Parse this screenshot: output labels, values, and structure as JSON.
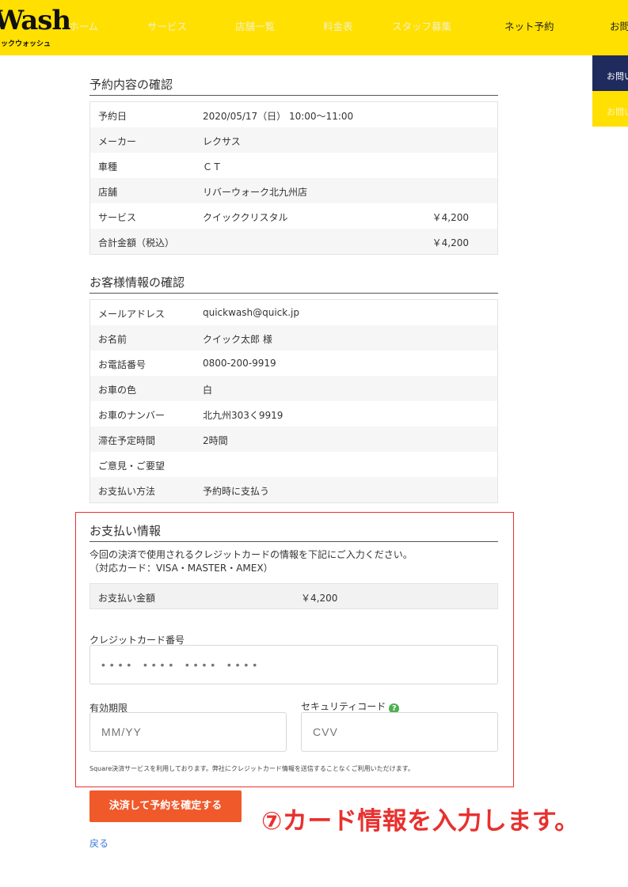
{
  "header": {
    "logo_main": "Wash",
    "logo_sub": "イックウォッシュ",
    "nav": [
      {
        "label": "ホーム"
      },
      {
        "label": "サービス"
      },
      {
        "label": "店舗一覧"
      },
      {
        "label": "料金表"
      },
      {
        "label": "スタッフ募集"
      },
      {
        "label": "ネット予約"
      },
      {
        "label": "お問"
      }
    ]
  },
  "side": {
    "contact_navy": "お問い",
    "contact_yellow": "お問い"
  },
  "reservation": {
    "title": "予約内容の確認",
    "rows": [
      {
        "k": "予約日",
        "v": "2020/05/17（日） 10:00〜11:00",
        "p": ""
      },
      {
        "k": "メーカー",
        "v": "レクサス",
        "p": ""
      },
      {
        "k": "車種",
        "v": "ＣＴ",
        "p": ""
      },
      {
        "k": "店舗",
        "v": "リバーウォーク北九州店",
        "p": ""
      },
      {
        "k": "サービス",
        "v": "クイッククリスタル",
        "p": "￥4,200"
      },
      {
        "k": "合計金額（税込）",
        "v": "",
        "p": "￥4,200"
      }
    ]
  },
  "customer": {
    "title": "お客様情報の確認",
    "rows": [
      {
        "k": "メールアドレス",
        "v": "quickwash@quick.jp"
      },
      {
        "k": "お名前",
        "v": "クイック太郎 様"
      },
      {
        "k": "お電話番号",
        "v": "0800-200-9919"
      },
      {
        "k": "お車の色",
        "v": "白"
      },
      {
        "k": "お車のナンバー",
        "v": "北九州303く9919"
      },
      {
        "k": "滞在予定時間",
        "v": "2時間"
      },
      {
        "k": "ご意見・ご要望",
        "v": ""
      },
      {
        "k": "お支払い方法",
        "v": "予約時に支払う"
      }
    ]
  },
  "payment": {
    "title": "お支払い情報",
    "desc_line1": "今回の決済で使用されるクレジットカードの情報を下記にご入力ください。",
    "desc_line2": "（対応カード：VISA・MASTER・AMEX）",
    "amount_label": "お支払い金額",
    "amount_value": "￥4,200",
    "card_label": "クレジットカード番号",
    "card_placeholder": "• • • •   • • • •   • • • •   • • • •",
    "expiry_label": "有効期限",
    "expiry_placeholder": "MM/YY",
    "cvv_label": "セキュリティコード",
    "cvv_help": "?",
    "cvv_placeholder": "CVV",
    "note": "Square決済サービスを利用しております。弊社にクレジットカード情報を送信することなくご利用いただけます。"
  },
  "actions": {
    "submit": "決済して予約を確定する",
    "back": "戻る"
  },
  "callout": "⑦カード情報を入力します。",
  "colors": {
    "header_yellow": "#ffe000",
    "navy": "#1f2b5c",
    "submit_orange": "#f0592a",
    "highlight_red": "#e8312f",
    "help_green": "#4caf50"
  }
}
